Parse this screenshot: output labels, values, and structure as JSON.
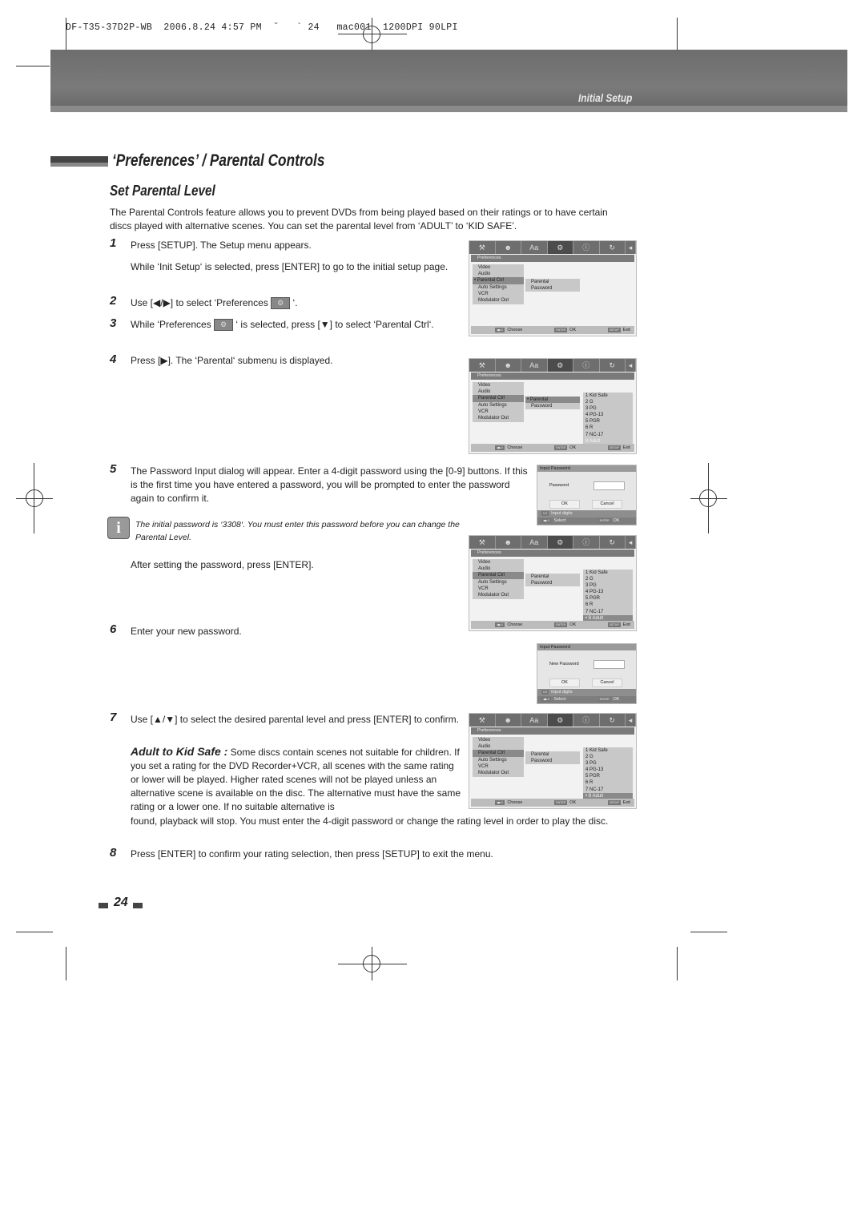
{
  "slug": "DF-T35-37D2P-WB  2006.8.24 4:57 PM  ˘   ` 24   mac001  1200DPI 90LPI",
  "header": {
    "section": "Initial Setup"
  },
  "title": "‘Preferences’ / Parental Controls",
  "subtitle": "Set Parental Level",
  "intro": "The Parental Controls feature allows you to prevent DVDs from being played based on their ratings or to have certain discs played with alternative scenes. You can set the parental level from ‘ADULT’ to ‘KID SAFE’.",
  "steps": {
    "s1": {
      "num": "1",
      "text": "Press [SETUP].  The Setup menu appears.",
      "text2": "While ‘Init Setup‘ is selected, press [ENTER] to go to the initial setup page."
    },
    "s2": {
      "num": "2",
      "text_a": "Use [◀/▶] to select ‘Preferences",
      "text_b": "‘."
    },
    "s3": {
      "num": "3",
      "text_a": "While ‘Preferences",
      "text_b": "‘ is selected, press [▼] to select ‘Parental Ctrl‘."
    },
    "s4": {
      "num": "4",
      "text": "Press [▶]. The ‘Parental‘ submenu is displayed."
    },
    "s5": {
      "num": "5",
      "text": "The Password Input dialog will appear. Enter a 4-digit password using the [0-9] buttons. If this is the first time you have entered a password, you will be prompted to enter the password again to confirm it.",
      "after": "After setting the password, press [ENTER]."
    },
    "s6": {
      "num": "6",
      "text": "Enter your new password."
    },
    "s7": {
      "num": "7",
      "text": "Use [▲/▼] to select the desired parental level and press [ENTER] to confirm.",
      "kid_label": "Adult to Kid Safe :",
      "kid_text": " Some discs contain scenes not suitable for children. If you set a rating for the DVD Recorder+VCR, all scenes with the same rating or lower will be played. Higher rated scenes will not be played unless an alternative scene is available on the disc. The alternative must have the same rating or a lower one. If no suitable alternative is",
      "kid_text2": "found, playback will stop. You must enter the 4-digit password or change the rating level in order to play the disc."
    },
    "s8": {
      "num": "8",
      "text": "Press [ENTER] to confirm your rating selection, then press [SETUP] to exit the menu."
    }
  },
  "note": {
    "icon": "info-icon",
    "text": "The initial password is ‘3308‘. You must enter this password before you can change the Parental Level."
  },
  "menu": {
    "tab_icons": [
      "tools-icon",
      "person-icon",
      "language-icon",
      "preferences-gear-icon",
      "info-icon",
      "refresh-icon",
      "arrow-icon"
    ],
    "selected_tab": 3,
    "panel_title": "Preferences",
    "items": [
      "Video",
      "Audio",
      "Parental Ctrl",
      "Auto Settings",
      "VCR",
      "Modulator Out"
    ],
    "sub_items": [
      "Parental",
      "Password"
    ],
    "ratings": [
      "1 Kid Safe",
      "2 G",
      "3 PG",
      "4 PG-13",
      "5 PGR",
      "6 R",
      "7 NC-17",
      "8 Adult"
    ],
    "footer": {
      "choose_key": "◀▶⇕",
      "choose": "Choose",
      "ok_key": "ENTER",
      "ok": "OK",
      "exit_key": "SETUP",
      "exit": "Exit"
    }
  },
  "password_dialogs": [
    {
      "title": "Input Password",
      "label": "Password",
      "ok": "OK",
      "cancel": "Cancel",
      "hint_key": "0-9",
      "hint": "Input digits",
      "select_key": "◀▶⇕",
      "select": "Select",
      "ok_key": "ENTER",
      "ok2": "OK"
    },
    {
      "title": "Input Password",
      "label": "New Password",
      "ok": "OK",
      "cancel": "Cancel",
      "hint_key": "0-9",
      "hint": "Input digits",
      "select_key": "◀▶⇕",
      "select": "Select",
      "ok_key": "ENTER",
      "ok2": "OK"
    }
  ],
  "screens": [
    {
      "marker": "items",
      "show_ratings": false
    },
    {
      "marker": "sub",
      "show_ratings": true,
      "rating_highlight": -1
    },
    {
      "marker": "none",
      "show_ratings": true,
      "rating_highlight": 7
    },
    {
      "marker": "rating",
      "show_ratings": true,
      "rating_highlight": 7
    }
  ],
  "page_number": "24"
}
